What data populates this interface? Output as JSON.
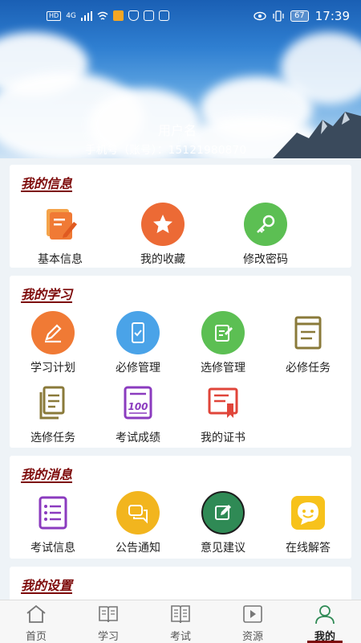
{
  "status_bar": {
    "left_badges": [
      "HD",
      "4G"
    ],
    "battery": "67",
    "time": "17:39"
  },
  "header": {
    "username": "用户名",
    "account": "手机号（账号）：15121980870"
  },
  "sections": {
    "info": {
      "title": "我的信息",
      "items": [
        {
          "label": "基本信息",
          "icon": "profile-edit-icon",
          "color": "#f07a35"
        },
        {
          "label": "我的收藏",
          "icon": "star-icon",
          "color": "#ec6a35"
        },
        {
          "label": "修改密码",
          "icon": "key-icon",
          "color": "#4fb84a"
        }
      ]
    },
    "study": {
      "title": "我的学习",
      "items": [
        {
          "label": "学习计划",
          "icon": "pencil-icon",
          "color": "#f07a35"
        },
        {
          "label": "必修管理",
          "icon": "phone-check-icon",
          "color": "#4aa3e8"
        },
        {
          "label": "选修管理",
          "icon": "note-edit-icon",
          "color": "#5cbf53"
        },
        {
          "label": "必修任务",
          "icon": "book-icon",
          "color": "#8a7a3a"
        },
        {
          "label": "选修任务",
          "icon": "documents-icon",
          "color": "#8a7a3a"
        },
        {
          "label": "考试成绩",
          "icon": "score-100-icon",
          "color": "#8b3bbf"
        },
        {
          "label": "我的证书",
          "icon": "certificate-icon",
          "color": "#e0453a"
        }
      ]
    },
    "messages": {
      "title": "我的消息",
      "items": [
        {
          "label": "考试信息",
          "icon": "list-icon",
          "color": "#8b3bbf"
        },
        {
          "label": "公告通知",
          "icon": "chat-bubbles-icon",
          "color": "#f2b51e"
        },
        {
          "label": "意见建议",
          "icon": "feedback-edit-icon",
          "color": "#2f8a55"
        },
        {
          "label": "在线解答",
          "icon": "smiley-icon",
          "color": "#f7c21b"
        }
      ]
    },
    "settings": {
      "title": "我的设置"
    }
  },
  "bottom_nav": {
    "items": [
      {
        "label": "首页",
        "icon": "home-icon"
      },
      {
        "label": "学习",
        "icon": "open-book-icon"
      },
      {
        "label": "考试",
        "icon": "exam-book-icon"
      },
      {
        "label": "资源",
        "icon": "play-icon"
      },
      {
        "label": "我的",
        "icon": "user-icon"
      }
    ],
    "active": "我的",
    "accent": "#7d0a0a"
  }
}
